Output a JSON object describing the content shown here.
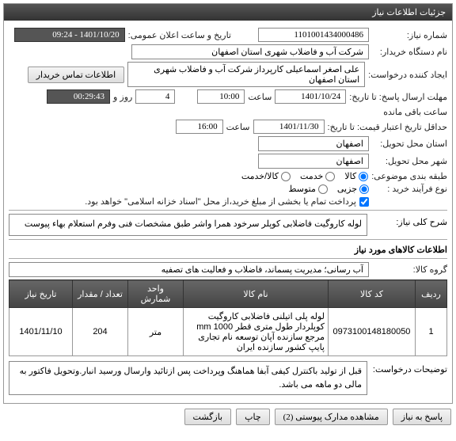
{
  "panel": {
    "title": "جزئیات اطلاعات نیاز"
  },
  "fields": {
    "need_no_label": "شماره نیاز:",
    "need_no": "1101001434000486",
    "announce_label": "تاریخ و ساعت اعلان عمومی:",
    "announce": "1401/10/20 - 09:24",
    "buyer_label": "نام دستگاه خریدار:",
    "buyer": "شرکت آب و فاضلاب شهری استان اصفهان",
    "requester_label": "ایجاد کننده درخواست:",
    "requester": "علی اصغر اسماعیلی کارپرداز شرکت آب و فاضلاب شهری استان اصفهان",
    "contact_btn": "اطلاعات تماس خریدار",
    "deadline_reply_label": "مهلت ارسال پاسخ: تا تاریخ:",
    "deadline_reply_date": "1401/10/24",
    "time_label": "ساعت",
    "deadline_reply_time": "10:00",
    "days_label": "روز و",
    "days_value": "4",
    "remaining_label": "ساعت باقی مانده",
    "remaining_time": "00:29:43",
    "min_valid_label": "حداقل تاریخ اعتبار قیمت: تا تاریخ:",
    "min_valid_date": "1401/11/30",
    "min_valid_time": "16:00",
    "city_label": "شهر محل تحویل:",
    "city": "اصفهان",
    "province_label": "استان محل تحویل:",
    "province": "اصفهان",
    "category_label": "طبقه بندی موضوعی:",
    "purchase_type_label": "نوع فرآیند خرید :",
    "payment_note": "پرداخت تمام یا بخشی از مبلغ خرید،از محل \"اسناد خزانه اسلامی\" خواهد بود."
  },
  "categories": {
    "opt1": "کالا",
    "opt2": "خدمت",
    "opt3": "کالا/خدمت"
  },
  "purchase_types": {
    "opt1": "جزیی",
    "opt2": "متوسط"
  },
  "general": {
    "label": "شرح کلی نیاز:",
    "text": "لوله کاروگیت فاضلابی کوپلر سرخود همرا واشر طبق مشخصات فنی وفرم استعلام بهاء پیوست"
  },
  "goods_section": {
    "title": "اطلاعات کالاهای مورد نیاز",
    "group_label": "گروه کالا:",
    "group_value": "آب رسانی؛ مدیریت پسماند، فاضلاب و فعالیت های تصفیه"
  },
  "table": {
    "headers": {
      "row": "ردیف",
      "code": "کد کالا",
      "name": "نام کالا",
      "unit": "واحد شمارش",
      "qty": "تعداد / مقدار",
      "date": "تاریخ نیاز"
    },
    "rows": [
      {
        "row": "1",
        "code": "0973100148180050",
        "name": "لوله پلی اتیلنی فاضلابی کاروگیت کوپلردار طول متری قطر 1000 mm مرجع سازنده آپان توسعه نام تجاری پایپ کشور سازنده ایران",
        "unit": "متر",
        "qty": "204",
        "date": "1401/11/10"
      }
    ]
  },
  "requester_notes": {
    "label": "توضیحات درخواست:",
    "text": "قبل از تولید باکنترل کیفی آبفا هماهنگ وپرداخت پس ازتائید وارسال ورسید انبار.وتحویل فاکتور به مالی دو ماهه می باشد."
  },
  "actions": {
    "respond": "پاسخ به نیاز",
    "attachments": "مشاهده مدارک پیوستی (2)",
    "print": "چاپ",
    "back": "بازگشت"
  }
}
